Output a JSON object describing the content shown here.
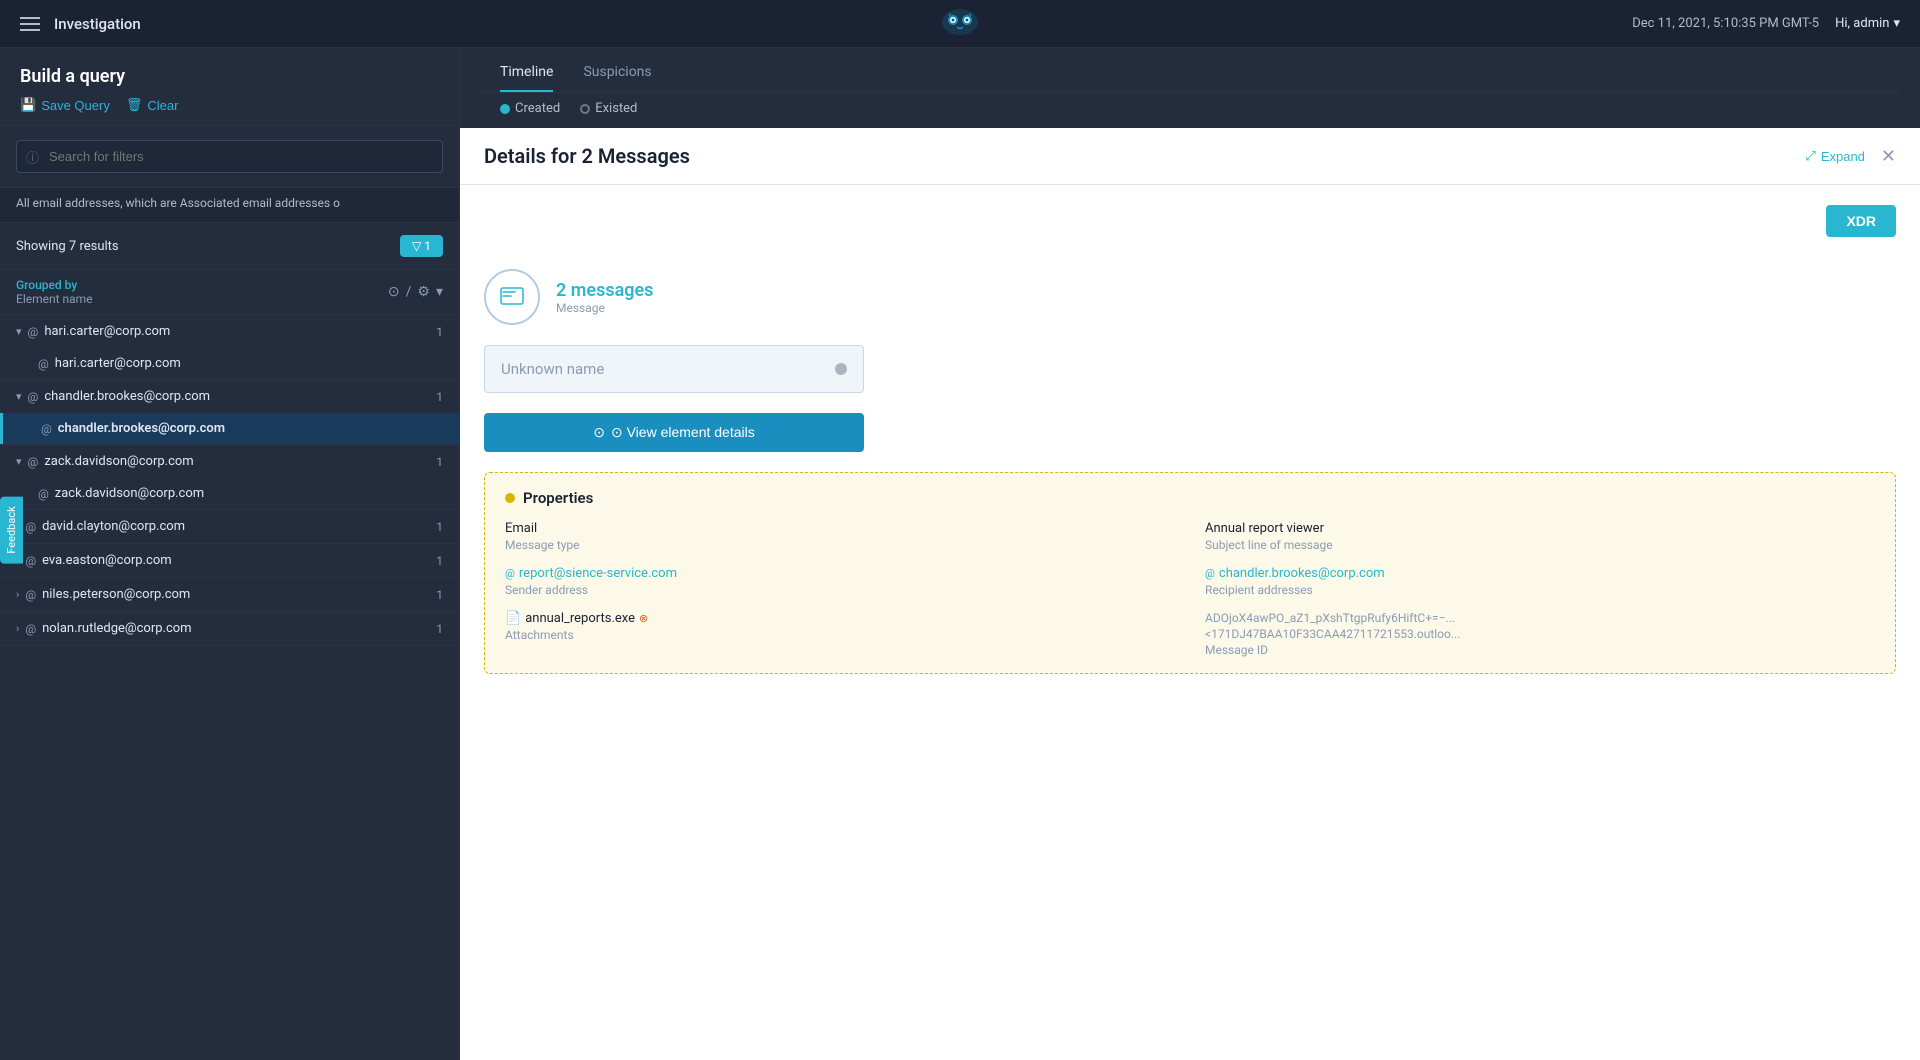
{
  "nav": {
    "title": "Investigation",
    "datetime": "Dec 11, 2021, 5:10:35 PM GMT-5",
    "user": "Hi, admin"
  },
  "leftPanel": {
    "queryTitle": "Build a query",
    "saveLabel": "Save Query",
    "clearLabel": "Clear",
    "searchPlaceholder": "Search for filters",
    "filterDesc": "All email addresses, which are Associated email addresses o",
    "resultsLabel": "Showing 7 results",
    "filterBadge": "▽ 1",
    "groupedByLabel": "Grouped by",
    "elementNameLabel": "Element name",
    "emails": [
      {
        "address": "hari.carter@corp.com",
        "count": 1,
        "expanded": true,
        "children": [
          "hari.carter@corp.com"
        ],
        "selected": false
      },
      {
        "address": "chandler.brookes@corp.com",
        "count": 1,
        "expanded": true,
        "children": [
          "chandler.brookes@corp.com"
        ],
        "selected": true
      },
      {
        "address": "zack.davidson@corp.com",
        "count": 1,
        "expanded": true,
        "children": [
          "zack.davidson@corp.com"
        ],
        "selected": false
      },
      {
        "address": "david.clayton@corp.com",
        "count": 1,
        "expanded": false,
        "children": [],
        "selected": false
      },
      {
        "address": "eva.easton@corp.com",
        "count": 1,
        "expanded": false,
        "children": [],
        "selected": false
      },
      {
        "address": "niles.peterson@corp.com",
        "count": 1,
        "expanded": false,
        "children": [],
        "selected": false
      },
      {
        "address": "nolan.rutledge@corp.com",
        "count": 1,
        "expanded": false,
        "children": [],
        "selected": false
      }
    ]
  },
  "rightTabs": {
    "tabs": [
      "Timeline",
      "Suspicions"
    ],
    "activeTab": "Timeline",
    "radioOptions": [
      "Created",
      "Existed"
    ]
  },
  "detailPanel": {
    "title": "Details for 2 Messages",
    "expandLabel": "Expand",
    "closeIcon": "✕",
    "xdrLabel": "XDR",
    "messageCount": "2 messages",
    "messageType": "Message",
    "unknownName": "Unknown name",
    "viewDetailsLabel": "⊙ View element details",
    "propertiesTitle": "Properties",
    "properties": {
      "email": {
        "label": "Email",
        "value": ""
      },
      "annualReportViewer": {
        "label": "Annual report viewer",
        "value": ""
      },
      "messageType": {
        "label": "Message type",
        "value": ""
      },
      "subjectLine": {
        "label": "Subject line of message",
        "value": ""
      },
      "senderAddress": {
        "label": "Sender address",
        "value": "report@sience-service.com"
      },
      "recipientAddresses": {
        "label": "Recipient addresses",
        "value": "chandler.brookes@corp.com"
      },
      "attachments": {
        "label": "Attachments",
        "value": "annual_reports.exe"
      },
      "messageId": {
        "label": "Message ID",
        "value1": "ADOjoX4awPO_aZ1_pXshTtgpRufy6HiftC+=−...",
        "value2": "<171DJ47BAA10F33CAA42711721553.outloo..."
      }
    }
  },
  "feedback": {
    "label": "Feedback"
  }
}
